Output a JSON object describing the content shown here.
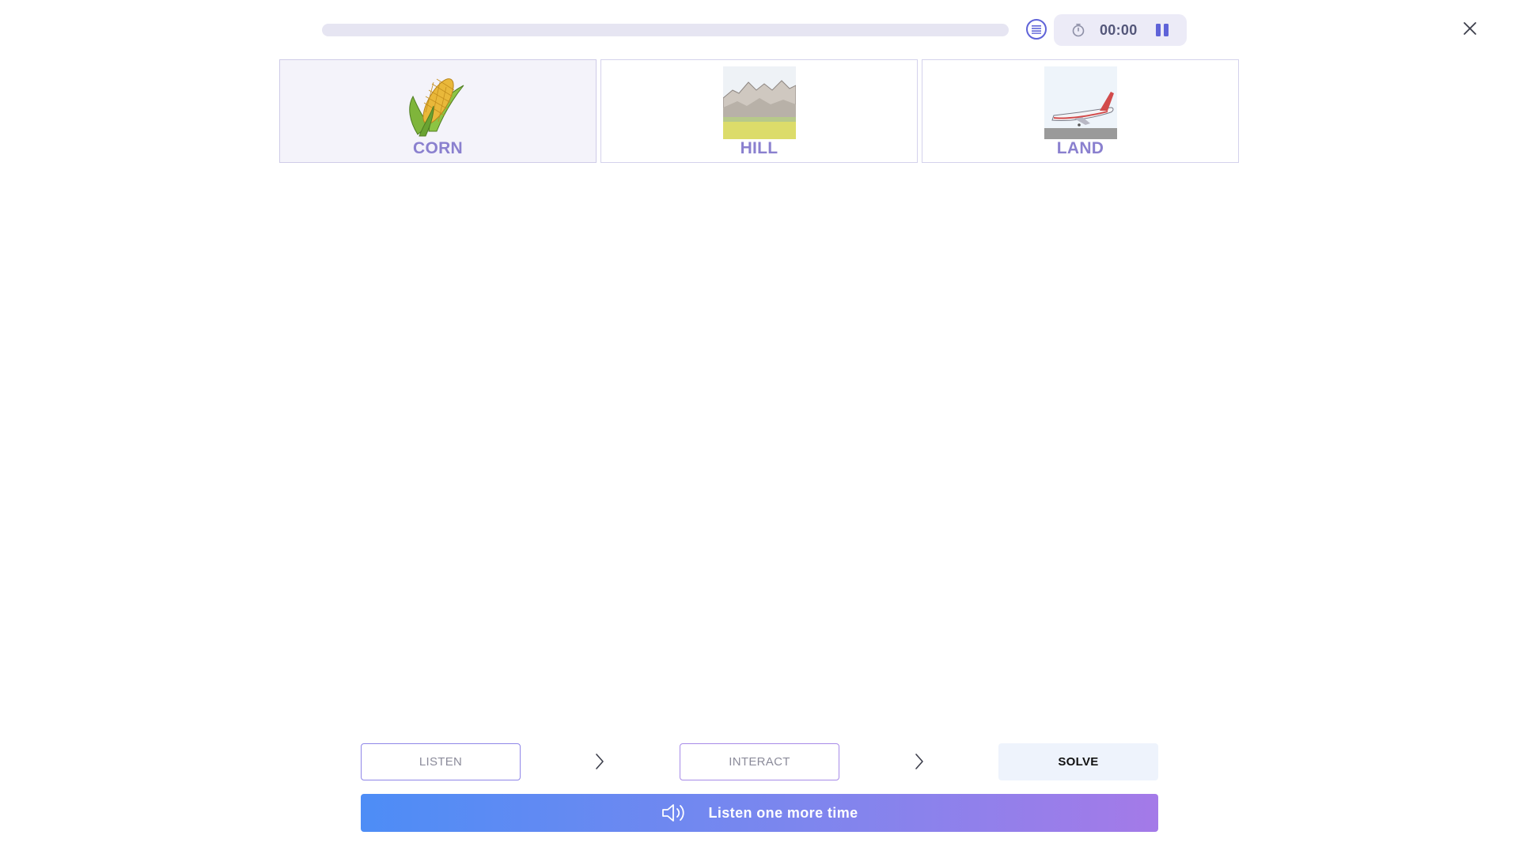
{
  "header": {
    "progress_fraction": 0,
    "timer": "00:00"
  },
  "cards": [
    {
      "label": "CORN",
      "image": "corn-image",
      "selected": true
    },
    {
      "label": "HILL",
      "image": "hill-image",
      "selected": false
    },
    {
      "label": "LAND",
      "image": "airplane-landing-image",
      "selected": false
    }
  ],
  "steps": {
    "listen": "LISTEN",
    "interact": "INTERACT",
    "solve": "SOLVE"
  },
  "listen_button": {
    "label": "Listen one more time",
    "icon": "speaker-icon"
  },
  "icons": {
    "menu": "list-menu-icon",
    "timer": "stopwatch-icon",
    "pause": "pause-icon",
    "close": "close-icon",
    "step_arrow": "chevron-right-icon"
  },
  "colors": {
    "accent": "#5f63d8",
    "card_label": "#8a80cf",
    "gradient_start": "#4d8df6",
    "gradient_end": "#a47ae8"
  }
}
